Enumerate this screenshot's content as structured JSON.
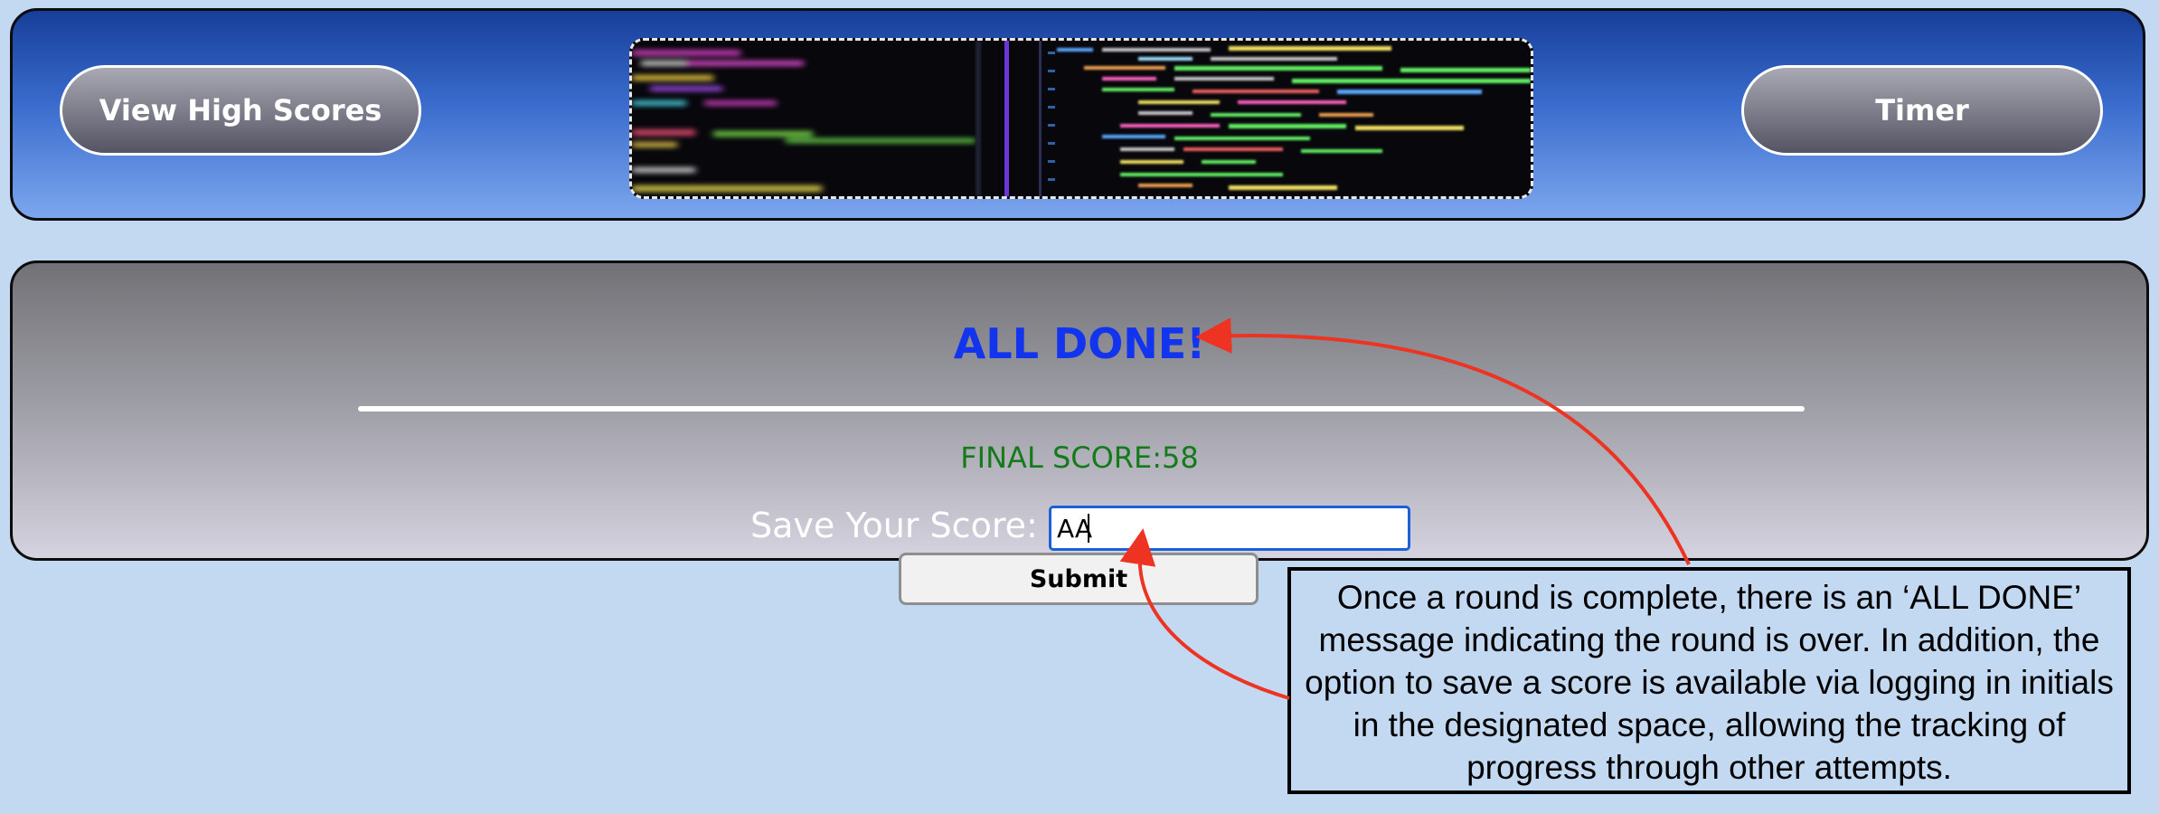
{
  "header": {
    "high_scores_label": "View High Scores",
    "timer_label": "Timer",
    "banner_image": "blurred-code-screen-image"
  },
  "main": {
    "title": "ALL DONE!",
    "final_score_label": "FINAL SCORE:",
    "final_score_value": 58,
    "final_score_text": "FINAL SCORE:58",
    "save_label": "Save Your Score:",
    "initials_value": "AA",
    "submit_label": "Submit"
  },
  "annotation": {
    "text": "Once a round is complete, there is an ‘ALL DONE’ message indicating the round is over. In addition, the option to save a score is available via logging in initials in the designated space, allowing the tracking of progress through other attempts."
  },
  "colors": {
    "page_background": "#c3d8f1",
    "header_gradient_top": "#163e99",
    "header_gradient_bottom": "#7ca6ee",
    "title_color": "#1234ee",
    "score_color": "#157a1c",
    "input_border": "#1d5fd6",
    "arrow_color": "#ee3322"
  }
}
